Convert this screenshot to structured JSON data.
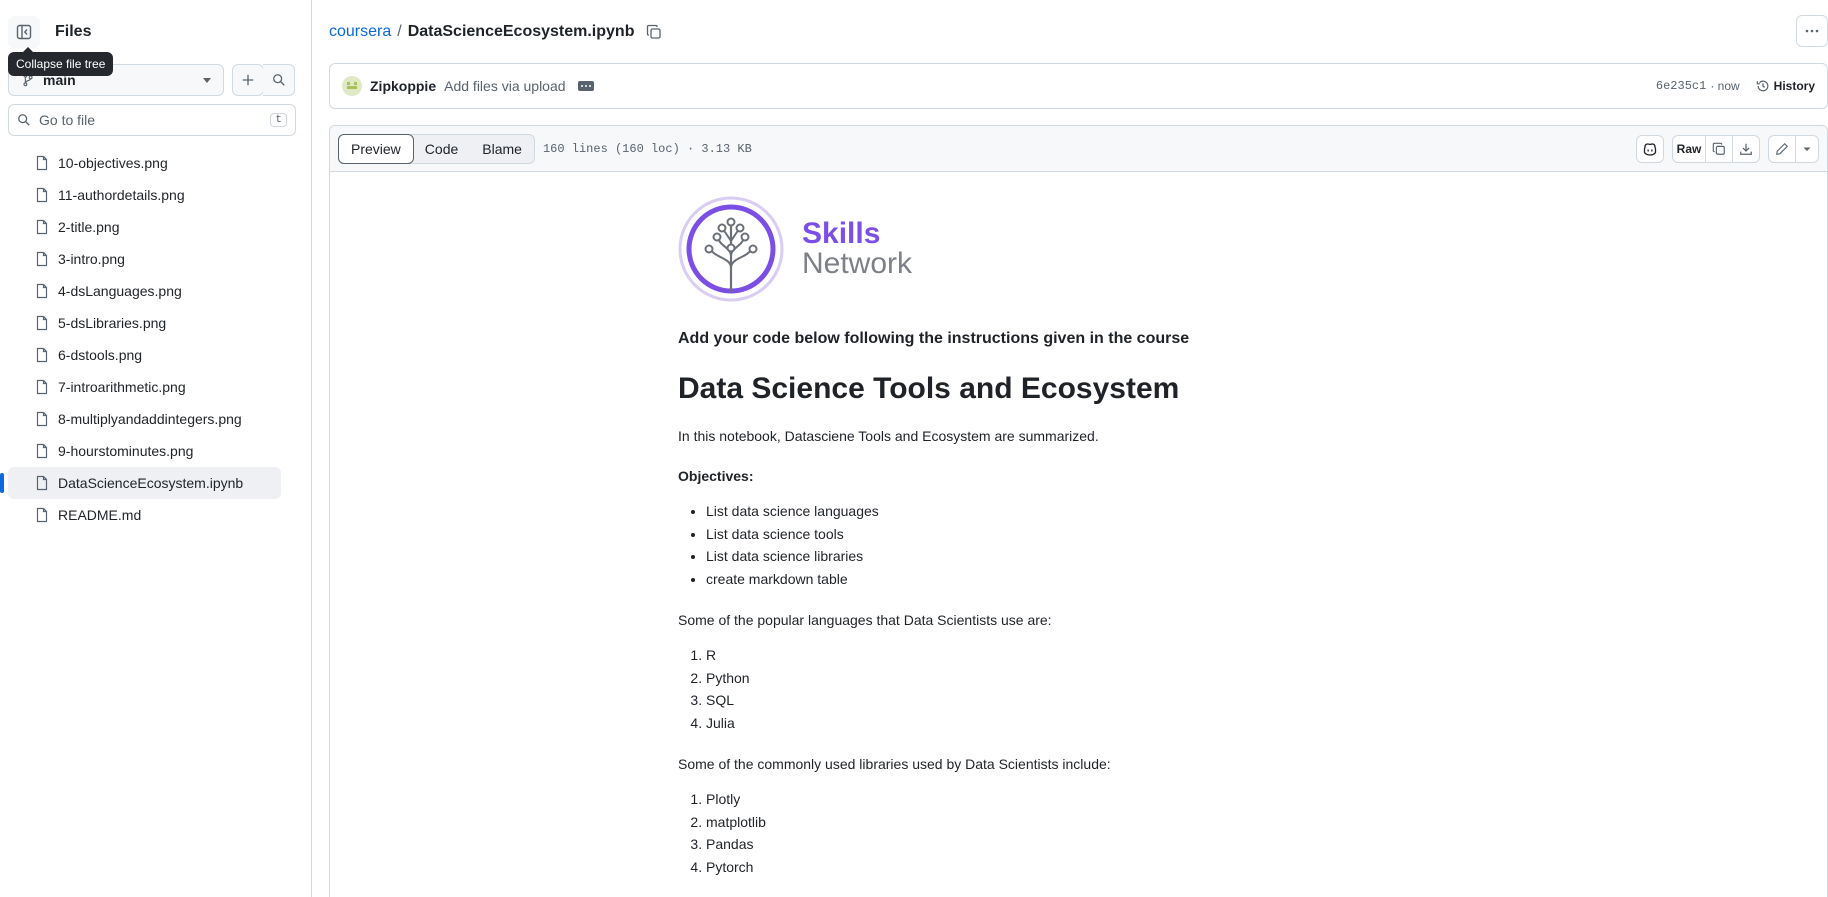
{
  "sidebar": {
    "title": "Files",
    "tooltip": "Collapse file tree",
    "branch": "main",
    "search_placeholder": "Go to file",
    "search_shortcut": "t",
    "files": [
      "10-objectives.png",
      "11-authordetails.png",
      "2-title.png",
      "3-intro.png",
      "4-dsLanguages.png",
      "5-dsLibraries.png",
      "6-dstools.png",
      "7-introarithmetic.png",
      "8-multiplyandaddintegers.png",
      "9-hourstominutes.png",
      "DataScienceEcosystem.ipynb",
      "README.md"
    ],
    "active_file": "DataScienceEcosystem.ipynb"
  },
  "breadcrumb": {
    "repo": "coursera",
    "separator": "/",
    "file": "DataScienceEcosystem.ipynb"
  },
  "commit": {
    "author": "Zipkoppie",
    "message": "Add files via upload",
    "sha": "6e235c1",
    "time": "· now",
    "history_label": "History"
  },
  "file_header": {
    "tabs": [
      "Preview",
      "Code",
      "Blame"
    ],
    "active_tab": "Preview",
    "meta": "160 lines (160 loc) · 3.13 KB",
    "raw_label": "Raw"
  },
  "notebook": {
    "logo_line1": "Skills",
    "logo_line2": "Network",
    "subtitle": "Add your code below following the instructions given in the course",
    "title": "Data Science Tools and Ecosystem",
    "intro": "In this notebook, Datasciene Tools and Ecosystem are summarized.",
    "objectives_label": "Objectives:",
    "objectives": [
      "List data science languages",
      "List data science tools",
      "List data science libraries",
      "create markdown table"
    ],
    "languages_intro": "Some of the popular languages that Data Scientists use are:",
    "languages": [
      "R",
      "Python",
      "SQL",
      "Julia"
    ],
    "libraries_intro": "Some of the commonly used libraries used by Data Scientists include:",
    "libraries": [
      "Plotly",
      "matplotlib",
      "Pandas",
      "Pytorch"
    ]
  },
  "colors": {
    "link": "#0969da",
    "brand_purple": "#7b4ee6",
    "border": "#d1d9e0"
  }
}
